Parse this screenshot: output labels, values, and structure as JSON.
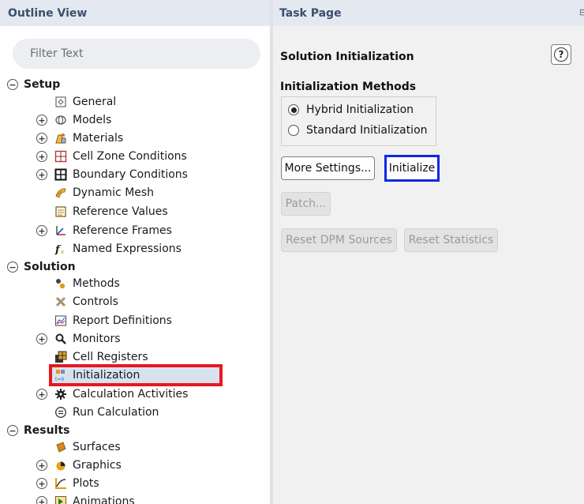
{
  "outline": {
    "title": "Outline View",
    "filter_placeholder": "Filter Text",
    "setup": "Setup",
    "general": "General",
    "models": "Models",
    "materials": "Materials",
    "cell_zone": "Cell Zone Conditions",
    "boundary": "Boundary Conditions",
    "dynamic_mesh": "Dynamic Mesh",
    "reference_values": "Reference Values",
    "reference_frames": "Reference Frames",
    "named_expressions": "Named Expressions",
    "solution": "Solution",
    "methods": "Methods",
    "controls": "Controls",
    "report_definitions": "Report Definitions",
    "monitors": "Monitors",
    "cell_registers": "Cell Registers",
    "initialization": "Initialization",
    "calculation_activities": "Calculation Activities",
    "run_calculation": "Run Calculation",
    "results": "Results",
    "surfaces": "Surfaces",
    "graphics": "Graphics",
    "plots": "Plots",
    "animations": "Animations",
    "selected_item": "Initialization",
    "highlight_color": "#e8171f"
  },
  "task": {
    "title": "Task Page",
    "section_title": "Solution Initialization",
    "help_label": "?",
    "methods_title": "Initialization Methods",
    "hybrid": "Hybrid  Initialization",
    "standard": "Standard Initialization",
    "selected_method": "Hybrid  Initialization",
    "more_settings": "More Settings...",
    "initialize": "Initialize",
    "patch": "Patch...",
    "reset_dpm": "Reset DPM Sources",
    "reset_statistics": "Reset Statistics",
    "focus_color": "#1027e6"
  }
}
